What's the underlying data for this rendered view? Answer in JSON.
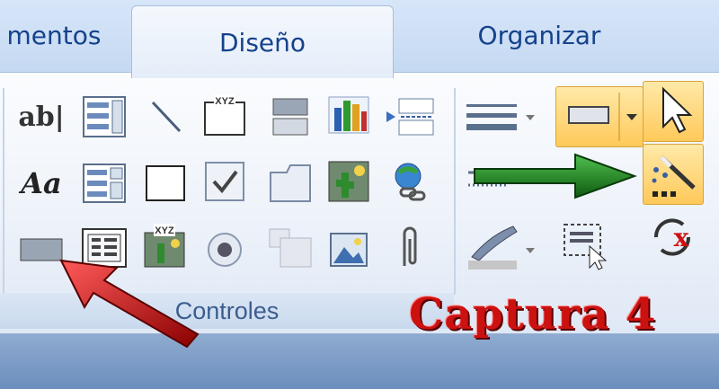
{
  "tabs": [
    {
      "label": "mentos"
    },
    {
      "label": "Diseño"
    },
    {
      "label": "Organizar"
    }
  ],
  "group": {
    "label": "Controles"
  },
  "controls": {
    "text_box": "ab|",
    "label": "Aa"
  },
  "annotation": {
    "caption": "Captura 4"
  },
  "icons": {
    "row1": [
      "text-box-icon",
      "list-box-icon",
      "line-icon",
      "group-frame-icon",
      "toggle-button-icon",
      "chart-icon",
      "insert-page-break-icon"
    ],
    "row2": [
      "label-icon",
      "combo-box-icon",
      "rectangle-icon",
      "checkbox-icon",
      "tab-control-icon",
      "image-icon",
      "hyperlink-icon"
    ],
    "row3": [
      "button-icon",
      "subform-icon",
      "unbound-object-frame-icon",
      "option-button-icon",
      "bound-object-frame-icon",
      "image-control-icon",
      "attachment-icon"
    ],
    "right": [
      "line-thickness-icon",
      "set-default-icon",
      "select-pointer-icon",
      "use-wizards-icon",
      "line-color-icon",
      "select-all-icon",
      "activex-icon"
    ]
  },
  "colors": {
    "highlight": "#ffc95a",
    "caption_red": "#cc1111",
    "green_arrow": "#1f8a1f",
    "red_arrow": "#d01010"
  }
}
